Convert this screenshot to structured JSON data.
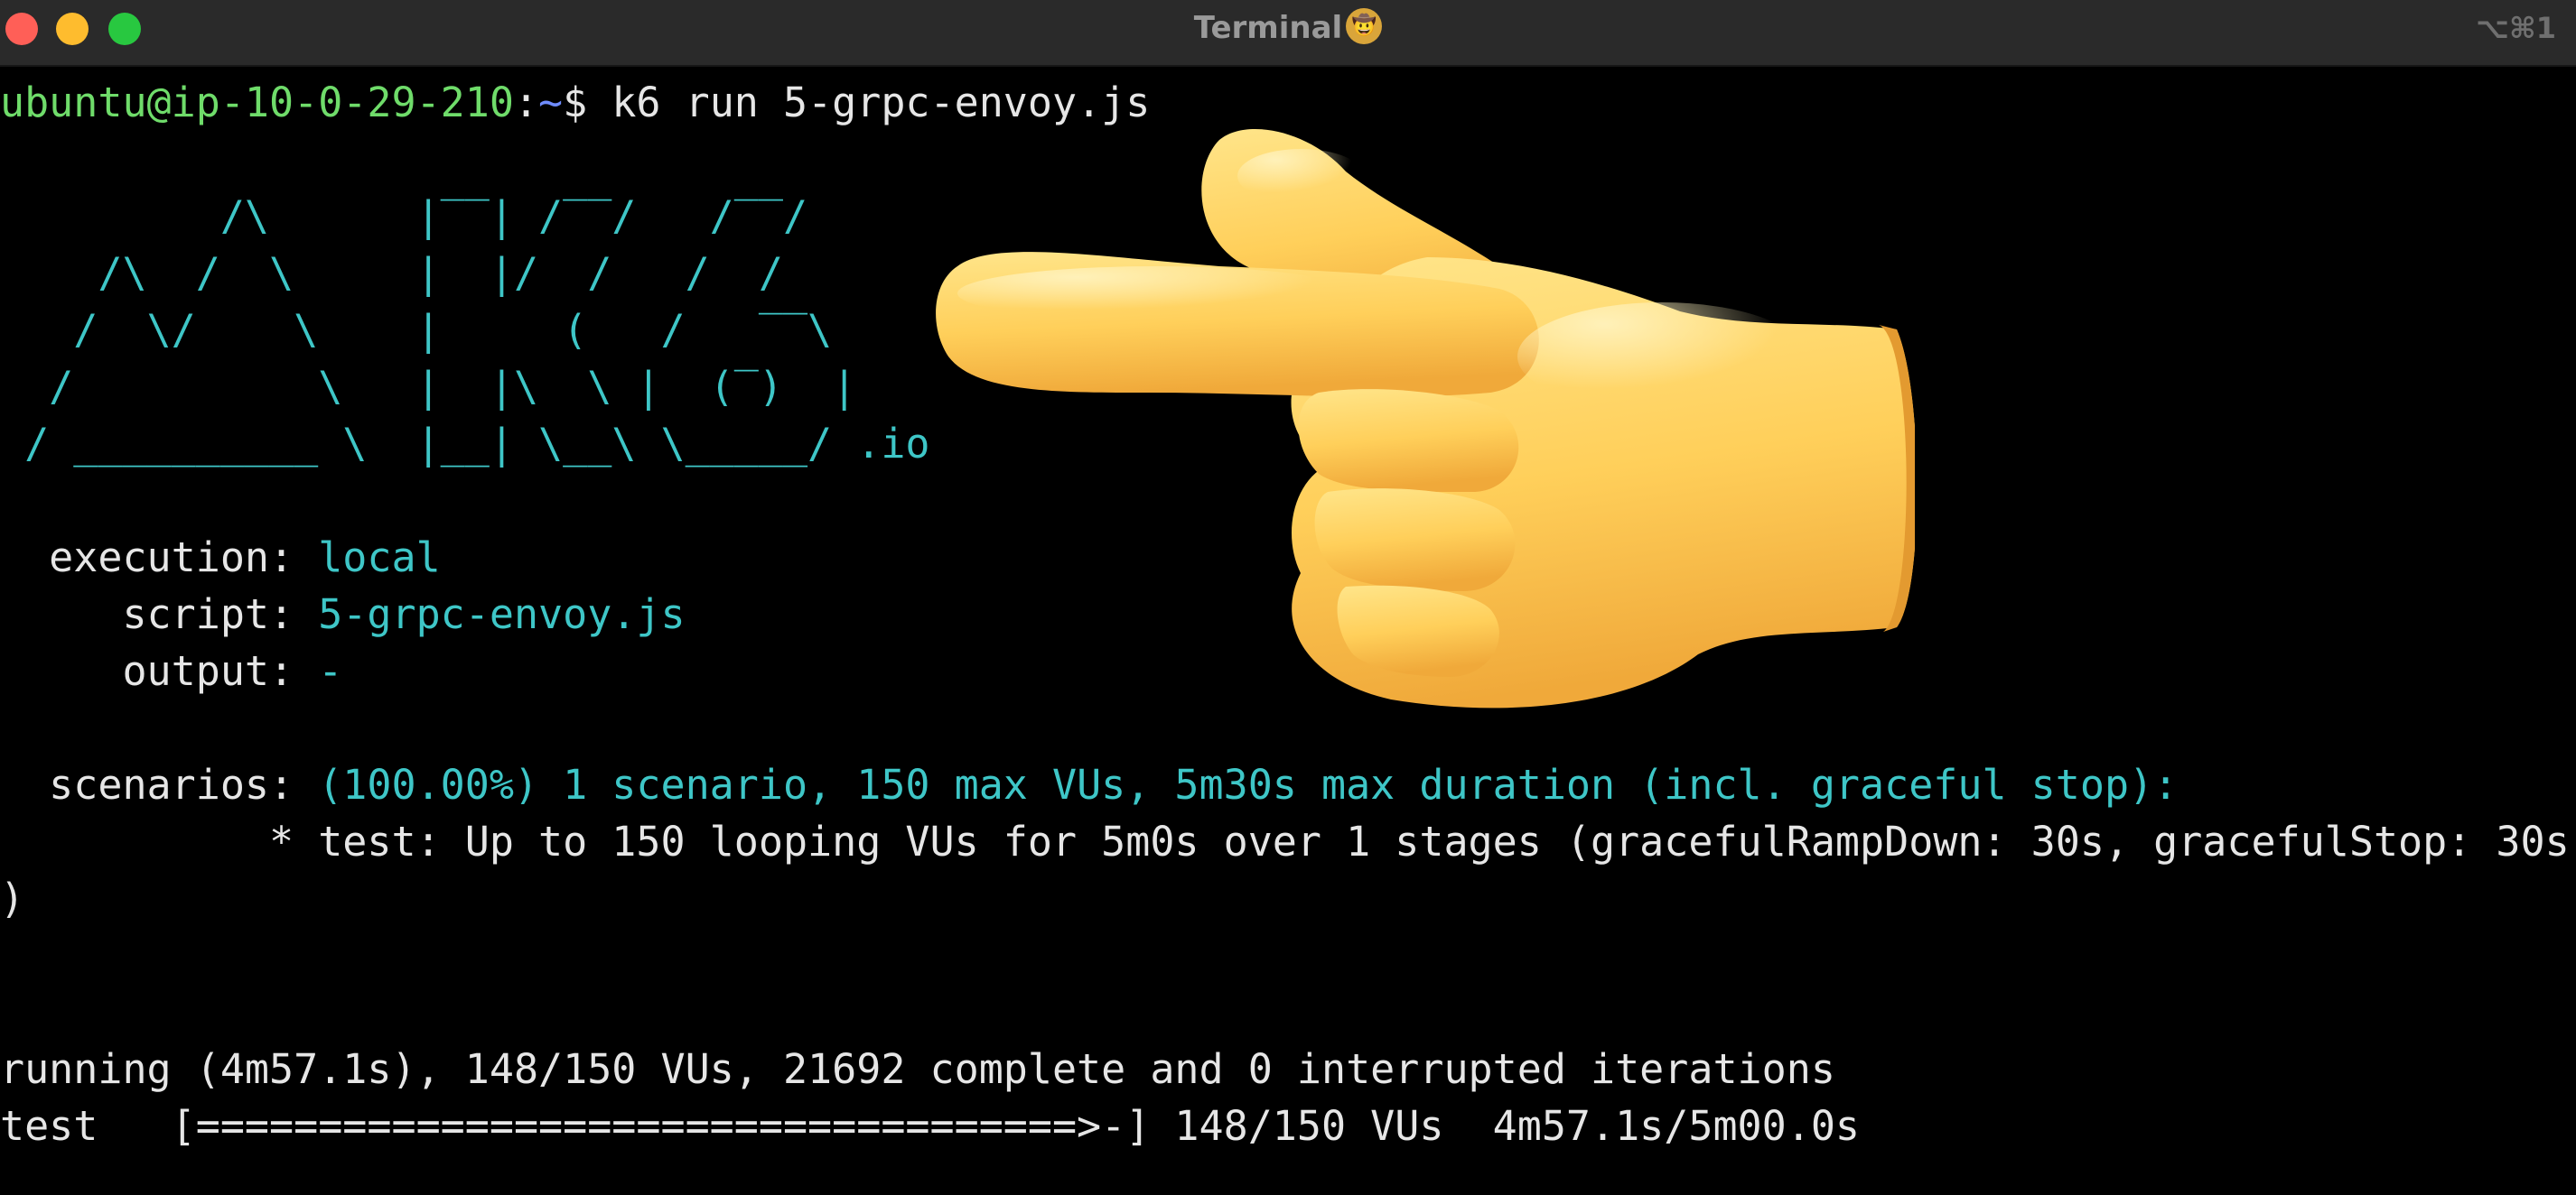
{
  "window": {
    "title": "Terminal",
    "badge": "🤠",
    "shortcut": "⌥⌘1"
  },
  "terminal": {
    "prompt_user_host": "ubuntu@ip-10-0-29-210",
    "prompt_sep": ":",
    "prompt_path": "~",
    "prompt_symbol": "$ ",
    "command": "k6 run 5-grpc-envoy.js",
    "logo": [
      "         /\\      |‾‾| /‾‾/   /‾‾/",
      "    /\\  /  \\     |  |/  /   /  /",
      "   /  \\/    \\    |     (   /   ‾‾\\",
      "  /          \\   |  |\\  \\ |  (‾)  |",
      " / __________ \\  |__| \\__\\ \\_____/"
    ],
    "logo_suffix": " .io",
    "execution_label": "  execution: ",
    "execution_value": "local",
    "script_label": "     script: ",
    "script_value": "5-grpc-envoy.js",
    "output_label": "     output: ",
    "output_value": "-",
    "scenarios_label": "  scenarios: ",
    "scenarios_value": "(100.00%) 1 scenario, 150 max VUs, 5m30s max duration (incl. graceful stop):",
    "scenario_detail": "           * test: Up to 150 looping VUs for 5m0s over 1 stages (gracefulRampDown: 30s, gracefulStop: 30s",
    "scenario_detail_wrap": ")",
    "running_line": "running (4m57.1s), 148/150 VUs, 21692 complete and 0 interrupted iterations",
    "progress_line": "test   [====================================>-] 148/150 VUs  4m57.1s/5m00.0s"
  },
  "overlay": {
    "icon": "pointing-hand-icon"
  },
  "colors": {
    "background": "#000000",
    "prompt_green": "#6fdc6a",
    "path_blue": "#6f8cff",
    "k6_cyan": "#3ec6c7",
    "text": "#e6e6e6"
  }
}
